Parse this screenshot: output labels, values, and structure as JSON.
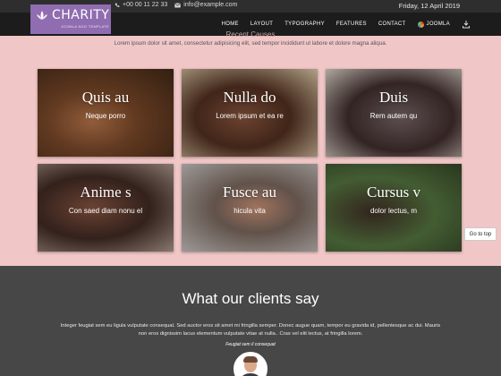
{
  "topbar": {
    "phone": "+00 00 11 22 33",
    "email": "info@example.com",
    "date": "Friday, 12 April 2019"
  },
  "logo": {
    "title": "CHARITY",
    "tagline": "JOOMLA NGO TEMPLATE"
  },
  "nav": {
    "items": [
      "HOME",
      "LAYOUT",
      "TYPOGRAPHY",
      "FEATURES",
      "CONTACT",
      "JOOMLA"
    ]
  },
  "intro": {
    "section_title": "Recent Causes",
    "text": "Lorem ipsum dolor sit amet, consectetur adipisicing elit, sed tempor incididunt ut labore et dolore magna aliqua."
  },
  "tiles": [
    {
      "title": "Quis au",
      "subtitle": "Neque porro"
    },
    {
      "title": "Nulla do",
      "subtitle": "Lorem ipsum et ea re"
    },
    {
      "title": "Duis",
      "subtitle": "Rem autem qu"
    },
    {
      "title": "Anime s",
      "subtitle": "Con saed diam nonu el"
    },
    {
      "title": "Fusce au",
      "subtitle": "hicula vita"
    },
    {
      "title": "Cursus v",
      "subtitle": "dolor lectus, m"
    }
  ],
  "go_to_top": "Go to top",
  "testimonials": {
    "heading": "What our clients say",
    "quote": "Integer feugiat sem eu ligula vulputate consequat. Sed auctor eros sit amet mi fringilla semper. Donec augue quam, tempor eu gravida id, pellentesque ac dui. Mauris non eros dignissim lacus elementum vulputate vitae at nulla.. Cras vel elit lectus, at fringilla lorem.",
    "author": "Feugiat sem il consequat"
  },
  "colors": {
    "page_bg": "#f0c6c6",
    "logo_bg": "#8f6db0",
    "nav_bg": "#1c1c1c",
    "testimonials_bg": "#474747"
  }
}
